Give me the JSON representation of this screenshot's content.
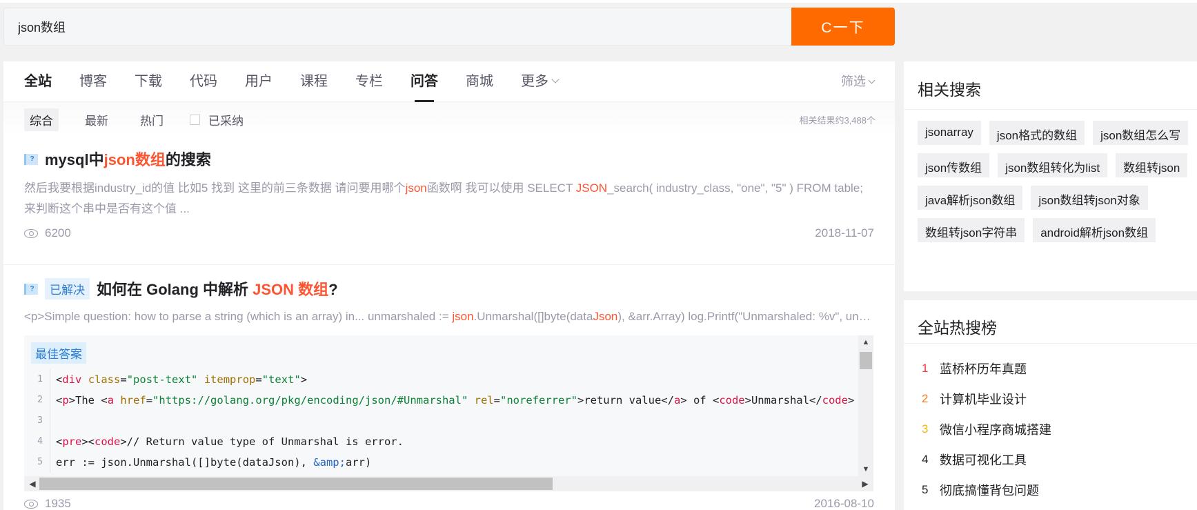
{
  "search": {
    "value": "json数组",
    "button": "C一下"
  },
  "tabs": [
    {
      "label": "全站"
    },
    {
      "label": "博客"
    },
    {
      "label": "下载"
    },
    {
      "label": "代码"
    },
    {
      "label": "用户"
    },
    {
      "label": "课程"
    },
    {
      "label": "专栏"
    },
    {
      "label": "问答"
    },
    {
      "label": "商城"
    },
    {
      "label": "更多"
    }
  ],
  "filter_label": "筛选",
  "subtabs": {
    "all": "综合",
    "newest": "最新",
    "hot": "热门",
    "accepted": "已采纳"
  },
  "result_count": "相关结果约3,488个",
  "results": [
    {
      "title_parts": [
        "mysql中",
        "json数组",
        "的搜索"
      ],
      "desc_parts": [
        "然后我要根据industry_id的值 比如5 找到 这里的前三条数据 请问要用哪个",
        "json",
        "函数啊 我可以使用 SELECT ",
        "JSON",
        "_search( industry_class, \"one\", \"5\" ) FROM table; 来判断这个串中是否有这个值 ..."
      ],
      "views": "6200",
      "date": "2018-11-07"
    },
    {
      "badge": "已解决",
      "title_parts": [
        "如何在 Golang 中解析 ",
        "JSON 数组",
        "?"
      ],
      "desc_parts": [
        "<p>Simple question: how to parse a string (which is an array) in... unmarshaled := ",
        "json",
        ".Unmarshal([]byte(data",
        "Json",
        "), &arr.Array) log.Printf(\"Unmarshaled: %v\", unmarshaled)"
      ],
      "best_label": "最佳答案",
      "code_lines": [
        {
          "n": "1",
          "parts": [
            "<",
            "div",
            " ",
            "class",
            "=",
            "\"post-text\"",
            " ",
            "itemprop",
            "=",
            "\"text\"",
            ">"
          ]
        },
        {
          "n": "2",
          "parts": [
            "<",
            "p",
            ">The <",
            "a",
            " ",
            "href",
            "=",
            "\"https://golang.org/pkg/encoding/json/#Unmarshal\"",
            " ",
            "rel",
            "=",
            "\"noreferrer\"",
            ">return value</",
            "a",
            "> of <",
            "code",
            ">Unmarshal</",
            "code",
            ">"
          ]
        },
        {
          "n": "3",
          "parts": [
            ""
          ]
        },
        {
          "n": "4",
          "parts": [
            "<",
            "pre",
            "><",
            "code",
            ">// Return value type of Unmarshal is error."
          ]
        },
        {
          "n": "5",
          "parts": [
            "err := json.Unmarshal([]byte(dataJson), ",
            "&amp;",
            "arr)"
          ]
        }
      ],
      "views": "1935",
      "date": "2016-08-10"
    }
  ],
  "related": {
    "title": "相关搜索",
    "tags": [
      "jsonarray",
      "json格式的数组",
      "json数组怎么写",
      "json传数组",
      "json数组转化为list",
      "数组转json",
      "java解析json数组",
      "json数组转json对象",
      "数组转json字符串",
      "android解析json数组"
    ]
  },
  "hot": {
    "title": "全站热搜榜",
    "items": [
      {
        "rank": "1",
        "label": "蓝桥杯历年真题",
        "color": "#fc3535"
      },
      {
        "rank": "2",
        "label": "计算机毕业设计",
        "color": "#ff7a1c"
      },
      {
        "rank": "3",
        "label": "微信小程序商城搭建",
        "color": "#f5b800"
      },
      {
        "rank": "4",
        "label": "数据可视化工具",
        "color": "#222226"
      },
      {
        "rank": "5",
        "label": "彻底搞懂背包问题",
        "color": "#222226"
      }
    ]
  },
  "colors": {
    "accent": "#ff6a00",
    "highlight": "#fc5531",
    "link_blue": "#2f7fd4"
  }
}
